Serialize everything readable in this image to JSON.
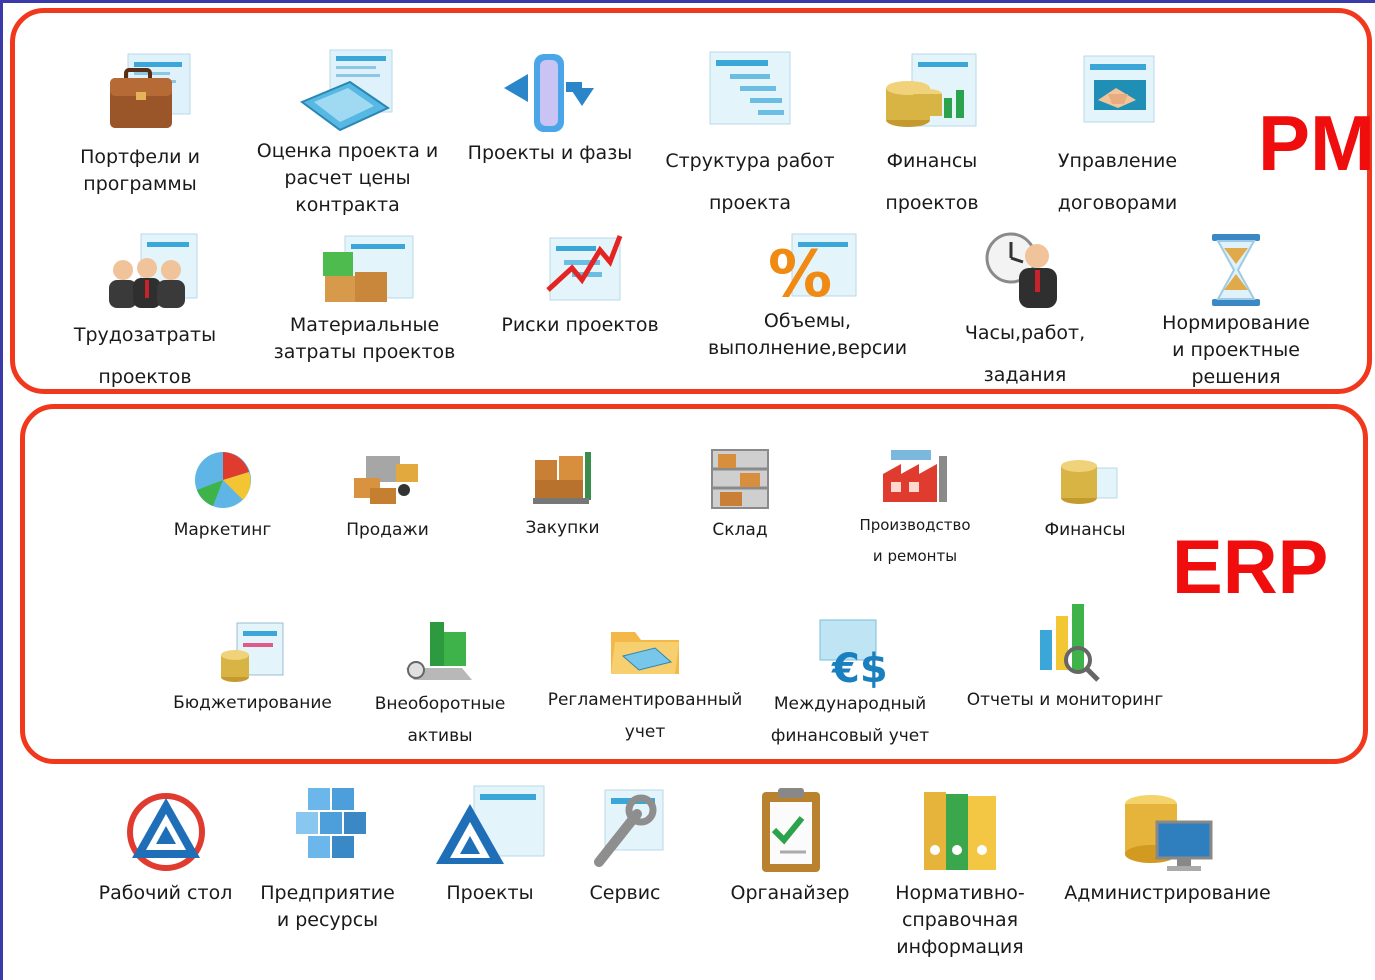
{
  "groups": {
    "pm": {
      "title": "PM",
      "items": [
        {
          "id": "portfolios",
          "icon": "briefcase-icon",
          "label": "Портфели  и\nпрограммы"
        },
        {
          "id": "estimate",
          "icon": "calculator-icon",
          "label": "Оценка  проекта  и\nрасчет цены\nконтракта"
        },
        {
          "id": "projects-phases",
          "icon": "phase-flow-icon",
          "label": "Проекты  и  фазы"
        },
        {
          "id": "wbs",
          "icon": "gantt-chart-icon",
          "label": "Структура работ\nпроекта"
        },
        {
          "id": "project-finance",
          "icon": "coins-chart-icon",
          "label": "Финансы\nпроектов"
        },
        {
          "id": "contracts",
          "icon": "handshake-icon",
          "label": "Управление\nдоговорами"
        },
        {
          "id": "labor",
          "icon": "people-icon",
          "label": "Трудозатраты\nпроектов"
        },
        {
          "id": "materials",
          "icon": "boxes-icon",
          "label": "Материальные\nзатраты проектов"
        },
        {
          "id": "risks",
          "icon": "risk-chart-icon",
          "label": "Риски  проектов"
        },
        {
          "id": "volumes",
          "icon": "percent-icon",
          "label": "Объемы,\nвыполнение,версии"
        },
        {
          "id": "hours",
          "icon": "clock-person-icon",
          "label": "Часы,работ,\nзадания"
        },
        {
          "id": "norms",
          "icon": "hourglass-icon",
          "label": "Нормирование\nи проектные\nрешения"
        }
      ]
    },
    "erp": {
      "title": "ERP",
      "items": [
        {
          "id": "marketing",
          "icon": "pie-chart-icon",
          "label": "Маркетинг"
        },
        {
          "id": "sales",
          "icon": "truck-icon",
          "label": "Продажи"
        },
        {
          "id": "purchases",
          "icon": "pallet-cart-icon",
          "label": "Закупки"
        },
        {
          "id": "warehouse",
          "icon": "shelves-icon",
          "label": "Склад"
        },
        {
          "id": "production",
          "icon": "factory-icon",
          "label": "Производство\nи ремонты"
        },
        {
          "id": "finance",
          "icon": "coins-icon",
          "label": "Финансы"
        },
        {
          "id": "budgeting",
          "icon": "budget-icon",
          "label": "Бюджетирование"
        },
        {
          "id": "fixed-assets",
          "icon": "machine-icon",
          "label": "Внеоборотные\nактивы"
        },
        {
          "id": "regulated",
          "icon": "folder-calculator-icon",
          "label": "Регламентированный\nучет"
        },
        {
          "id": "international",
          "icon": "euro-dollar-icon",
          "label": "Международный\nфинансовый учет"
        },
        {
          "id": "reports",
          "icon": "bar-chart-magnifier-icon",
          "label": "Отчеты и мониторинг"
        }
      ]
    }
  },
  "bottom": {
    "items": [
      {
        "id": "desktop",
        "icon": "desktop-logo-icon",
        "label": "Рабочий стол"
      },
      {
        "id": "enterprise",
        "icon": "cubes-icon",
        "label": "Предприятие\nи ресурсы"
      },
      {
        "id": "projects",
        "icon": "projects-logo-icon",
        "label": "Проекты"
      },
      {
        "id": "service",
        "icon": "wrench-icon",
        "label": "Сервис"
      },
      {
        "id": "organizer",
        "icon": "clipboard-icon",
        "label": "Органайзер"
      },
      {
        "id": "reference",
        "icon": "binders-icon",
        "label": "Нормативно-\nсправочная\nинформация"
      },
      {
        "id": "admin",
        "icon": "database-monitor-icon",
        "label": "Администрирование"
      }
    ]
  },
  "colors": {
    "frame": "#f1381c",
    "group_title": "#f00d0d",
    "window_border": "#3a3aa8"
  }
}
